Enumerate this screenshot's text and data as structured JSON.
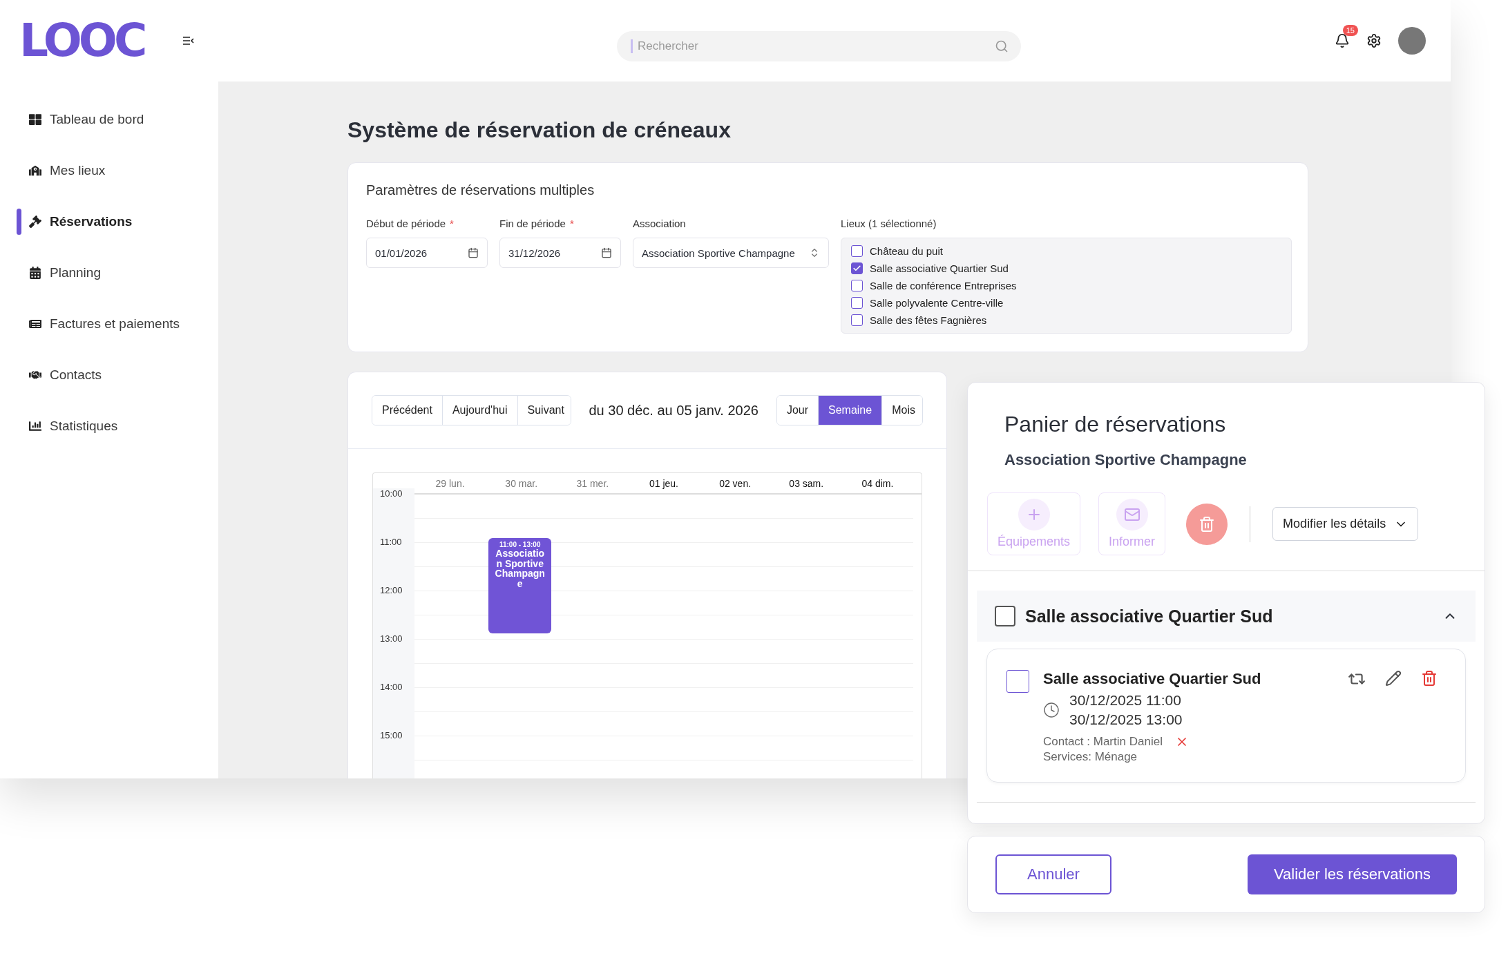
{
  "logo": {
    "text": "LOOC"
  },
  "search": {
    "placeholder": "Rechercher"
  },
  "notifications": {
    "count": "15"
  },
  "sidebar": {
    "items": [
      {
        "kind": "dashboard",
        "label": "Tableau de bord",
        "selected": false
      },
      {
        "kind": "places",
        "label": "Mes lieux",
        "selected": false
      },
      {
        "kind": "bookings",
        "label": "Réservations",
        "selected": true
      },
      {
        "kind": "planning",
        "label": "Planning",
        "selected": false
      },
      {
        "kind": "invoices",
        "label": "Factures et paiements",
        "selected": false
      },
      {
        "kind": "contacts",
        "label": "Contacts",
        "selected": false
      },
      {
        "kind": "stats",
        "label": "Statistiques",
        "selected": false
      }
    ]
  },
  "page_title": "Système de réservation de créneaux",
  "params": {
    "title": "Paramètres de réservations multiples",
    "fields": [
      {
        "kind": "date",
        "label": "Début de période",
        "required_mark": "*",
        "value": "01/01/2026"
      },
      {
        "kind": "date",
        "label": "Fin de période",
        "required_mark": "*",
        "value": "31/12/2026"
      },
      {
        "kind": "select",
        "label": "Association",
        "value": "Association Sportive Champagne"
      }
    ],
    "places": {
      "label": "Lieux (1 sélectionné)",
      "options": [
        {
          "label": "Château du puit",
          "checked": false
        },
        {
          "label": "Salle associative Quartier Sud",
          "checked": true
        },
        {
          "label": "Salle de conférence Entreprises",
          "checked": false
        },
        {
          "label": "Salle polyvalente Centre-ville",
          "checked": false
        },
        {
          "label": "Salle des fêtes Fagnières",
          "checked": false
        }
      ]
    }
  },
  "calendar": {
    "nav": [
      {
        "label": "Précédent"
      },
      {
        "label": "Aujourd'hui"
      },
      {
        "label": "Suivant"
      }
    ],
    "range": "du 30 déc. au 05 janv. 2026",
    "views": [
      {
        "label": "Jour",
        "selected": false
      },
      {
        "label": "Semaine",
        "selected": true
      },
      {
        "label": "Mois",
        "selected": false
      }
    ],
    "days": [
      {
        "label": "29 lun.",
        "past": true
      },
      {
        "label": "30 mar.",
        "past": true,
        "events": [
          {
            "time": "11:00 - 13:00",
            "title": "Association Sportive Champagne"
          }
        ]
      },
      {
        "label": "31 mer.",
        "past": true
      },
      {
        "label": "01 jeu.",
        "past": false
      },
      {
        "label": "02 ven.",
        "past": false
      },
      {
        "label": "03 sam.",
        "past": false
      },
      {
        "label": "04 dim.",
        "past": false
      }
    ],
    "hours": [
      "10:00",
      "11:00",
      "12:00",
      "13:00",
      "14:00",
      "15:00"
    ]
  },
  "panel": {
    "title": "Panier de réservations",
    "association": "Association Sportive Champagne",
    "actions": [
      {
        "kind": "add",
        "label": "Équipements",
        "disabled": true
      },
      {
        "kind": "mail",
        "label": "Informer",
        "disabled": true
      },
      {
        "kind": "delete",
        "disabled": true
      }
    ],
    "details_menu": {
      "label": "Modifier les détails"
    },
    "groups": [
      {
        "title": "Salle associative Quartier Sud",
        "checked": false,
        "expanded": true,
        "bookings": [
          {
            "title": "Salle associative Quartier Sud",
            "checked": false,
            "start": "30/12/2025 11:00",
            "end": "30/12/2025 13:00",
            "contact": "Contact : Martin Daniel",
            "services": "Services: Ménage"
          }
        ]
      }
    ]
  },
  "footer": {
    "cancel": "Annuler",
    "confirm": "Valider les réservations"
  }
}
